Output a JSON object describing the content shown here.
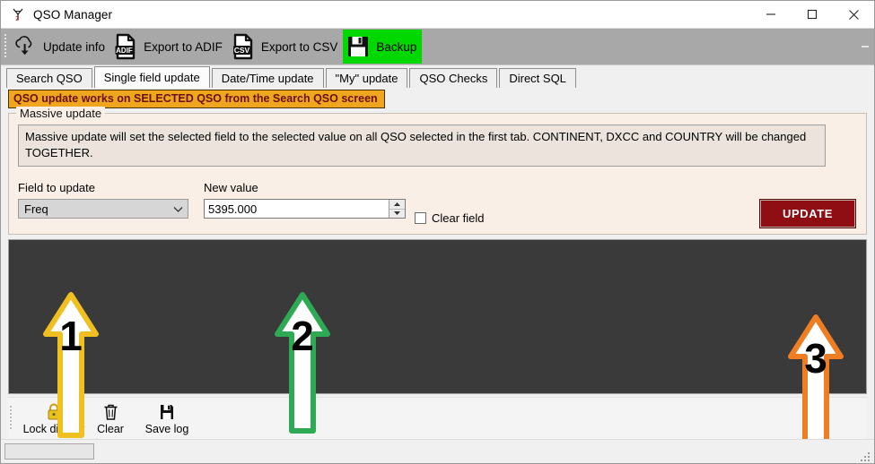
{
  "window": {
    "title": "QSO Manager",
    "app_icon": "antenna-icon",
    "minimize_label": "Minimize",
    "maximize_label": "Maximize",
    "close_label": "Close"
  },
  "toolbar": {
    "items": [
      {
        "label": "Update info",
        "icon": "cloud-download-icon",
        "highlighted": false
      },
      {
        "label": "Export to ADIF",
        "icon": "adif-file-icon",
        "highlighted": false
      },
      {
        "label": "Export to CSV",
        "icon": "csv-file-icon",
        "highlighted": false
      },
      {
        "label": "Backup",
        "icon": "floppy-disk-icon",
        "highlighted": true
      }
    ],
    "highlight_color": "#00d800",
    "overflow_icon": "toolbar-overflow-icon"
  },
  "tabs": {
    "selected_index": 1,
    "items": [
      {
        "label": "Search QSO"
      },
      {
        "label": "Single field update"
      },
      {
        "label": "Date/Time update"
      },
      {
        "label": "\"My\" update"
      },
      {
        "label": "QSO Checks"
      },
      {
        "label": "Direct SQL"
      }
    ]
  },
  "banner": {
    "text": "QSO update works on SELECTED QSO from the Search QSO screen",
    "background": "#f0a51e",
    "text_color": "#6b1010"
  },
  "massive_update": {
    "group_title": "Massive update",
    "description": "Massive update will set the selected field to the selected value on all QSO selected in the first tab. CONTINENT, DXCC and COUNTRY will be changed TOGETHER.",
    "field_label": "Field to update",
    "field_value": "Freq",
    "field_options": [
      "Freq"
    ],
    "value_label": "New value",
    "value_text": "5395.000",
    "value_placeholder": "",
    "clear_field_label": "Clear field",
    "clear_field_checked": false,
    "update_button_label": "UPDATE",
    "update_button_color": "#8f0e14"
  },
  "log": {
    "content": "",
    "background": "#3a3a3a"
  },
  "bottom_toolbar": {
    "items": [
      {
        "label": "Lock display",
        "icon": "padlock-icon"
      },
      {
        "label": "Clear",
        "icon": "trash-icon"
      },
      {
        "label": "Save log",
        "icon": "floppy-disk-icon"
      }
    ]
  },
  "statusbar": {
    "panel_text": "",
    "grip_icon": "resize-grip-icon"
  },
  "annotations": [
    {
      "number": "1",
      "color": "#f0c020",
      "target": "field-to-update-dropdown"
    },
    {
      "number": "2",
      "color": "#2eaa55",
      "target": "new-value-input"
    },
    {
      "number": "3",
      "color": "#ef7d22",
      "target": "update-button"
    }
  ]
}
